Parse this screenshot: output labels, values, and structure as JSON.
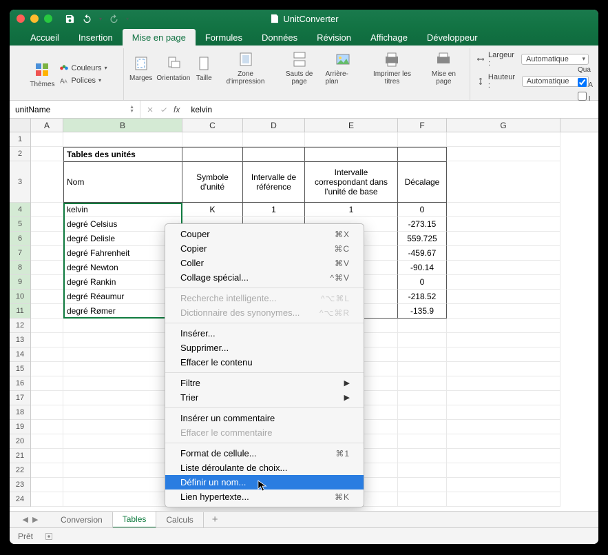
{
  "titlebar": {
    "app_title": "UnitConverter"
  },
  "ribbon_tabs": [
    "Accueil",
    "Insertion",
    "Mise en page",
    "Formules",
    "Données",
    "Révision",
    "Affichage",
    "Développeur"
  ],
  "active_tab": 2,
  "ribbon": {
    "themes": {
      "label": "Thèmes",
      "colors": "Couleurs",
      "fonts": "Polices"
    },
    "margins": "Marges",
    "orientation": "Orientation",
    "size": "Taille",
    "print_area": "Zone d'impression",
    "breaks": "Sauts de page",
    "background": "Arrière-plan",
    "print_titles": "Imprimer les titres",
    "page_setup": "Mise en page",
    "width_label": "Largeur :",
    "height_label": "Hauteur :",
    "auto": "Automatique"
  },
  "right_panel": {
    "label1": "Qua"
  },
  "name_box": "unitName",
  "formula": "kelvin",
  "columns": [
    "A",
    "B",
    "C",
    "D",
    "E",
    "F",
    "G"
  ],
  "col_widths": {
    "A": 47,
    "B": 173,
    "C": 88,
    "D": 90,
    "E": 135,
    "F": 71,
    "G": 165
  },
  "table": {
    "title": "Tables des unités",
    "headers": [
      "Nom",
      "Symbole d'unité",
      "Intervalle de référence",
      "Intervalle correspondant dans l'unité de base",
      "Décalage"
    ],
    "rows": [
      {
        "nom": "kelvin",
        "sym": "K",
        "ref": "1",
        "base": "1",
        "dec": "0"
      },
      {
        "nom": "degré Celsius",
        "sym": "",
        "ref": "",
        "base": "",
        "dec": "-273.15"
      },
      {
        "nom": "degré Delisle",
        "sym": "",
        "ref": "",
        "base": "",
        "dec": "559.725"
      },
      {
        "nom": "degré Fahrenheit",
        "sym": "",
        "ref": "",
        "base": "",
        "dec": "-459.67"
      },
      {
        "nom": "degré Newton",
        "sym": "",
        "ref": "",
        "base": "",
        "dec": "-90.14"
      },
      {
        "nom": "degré Rankin",
        "sym": "",
        "ref": "",
        "base": "",
        "dec": "0"
      },
      {
        "nom": "degré Réaumur",
        "sym": "",
        "ref": "",
        "base": "",
        "dec": "-218.52"
      },
      {
        "nom": "degré Rømer",
        "sym": "",
        "ref": "",
        "base": "",
        "dec": "-135.9"
      }
    ]
  },
  "context_menu": [
    {
      "label": "Couper",
      "shortcut": "⌘X"
    },
    {
      "label": "Copier",
      "shortcut": "⌘C"
    },
    {
      "label": "Coller",
      "shortcut": "⌘V"
    },
    {
      "label": "Collage spécial...",
      "shortcut": "^⌘V"
    },
    {
      "sep": true
    },
    {
      "label": "Recherche intelligente...",
      "shortcut": "^⌥⌘L",
      "disabled": true
    },
    {
      "label": "Dictionnaire des synonymes...",
      "shortcut": "^⌥⌘R",
      "disabled": true
    },
    {
      "sep": true
    },
    {
      "label": "Insérer..."
    },
    {
      "label": "Supprimer..."
    },
    {
      "label": "Effacer le contenu"
    },
    {
      "sep": true
    },
    {
      "label": "Filtre",
      "submenu": true
    },
    {
      "label": "Trier",
      "submenu": true
    },
    {
      "sep": true
    },
    {
      "label": "Insérer un commentaire"
    },
    {
      "label": "Effacer le commentaire",
      "disabled": true
    },
    {
      "sep": true
    },
    {
      "label": "Format de cellule...",
      "shortcut": "⌘1"
    },
    {
      "label": "Liste déroulante de choix..."
    },
    {
      "label": "Définir un nom...",
      "highlighted": true
    },
    {
      "label": "Lien hypertexte...",
      "shortcut": "⌘K"
    }
  ],
  "sheets": [
    "Conversion",
    "Tables",
    "Calculs"
  ],
  "active_sheet": 1,
  "status": "Prêt"
}
